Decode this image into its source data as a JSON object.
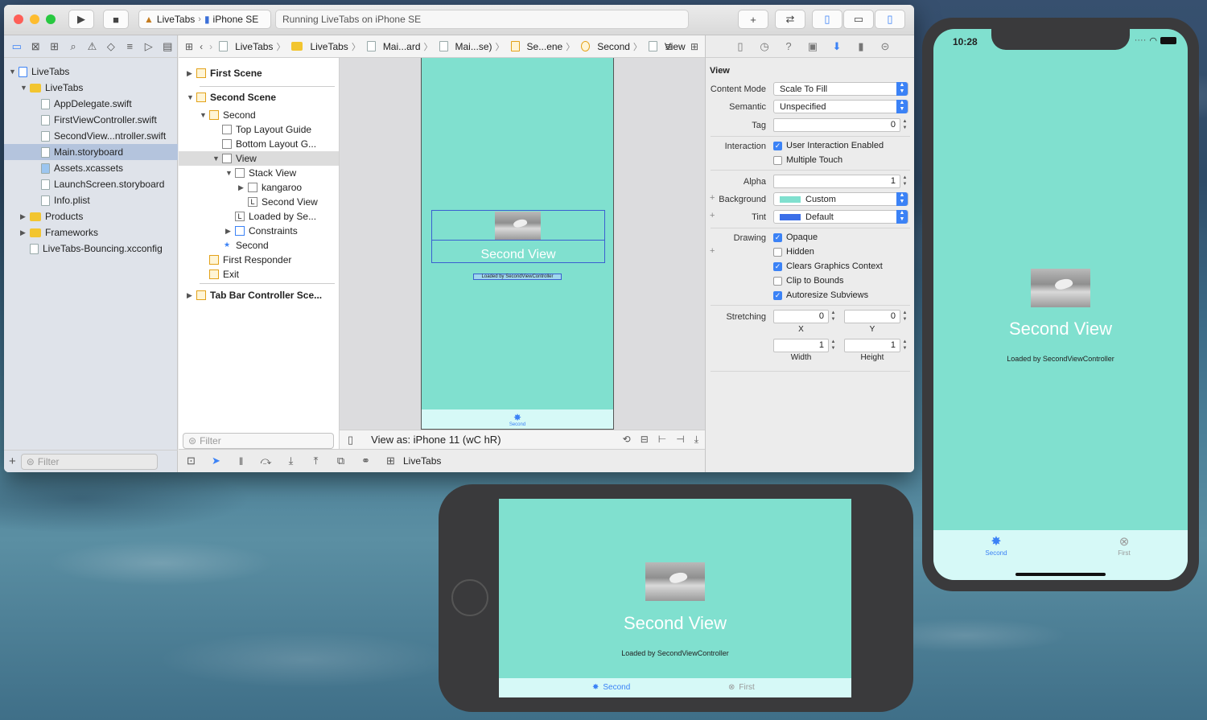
{
  "toolbar": {
    "scheme_target": "LiveTabs",
    "scheme_device": "iPhone SE",
    "status": "Running LiveTabs on iPhone SE"
  },
  "navigator": {
    "items": [
      {
        "label": "LiveTabs",
        "kind": "project"
      },
      {
        "label": "LiveTabs",
        "kind": "folder"
      },
      {
        "label": "AppDelegate.swift",
        "kind": "file"
      },
      {
        "label": "FirstViewController.swift",
        "kind": "file"
      },
      {
        "label": "SecondView...ntroller.swift",
        "kind": "file"
      },
      {
        "label": "Main.storyboard",
        "kind": "file",
        "selected": true
      },
      {
        "label": "Assets.xcassets",
        "kind": "assets"
      },
      {
        "label": "LaunchScreen.storyboard",
        "kind": "file"
      },
      {
        "label": "Info.plist",
        "kind": "file"
      },
      {
        "label": "Products",
        "kind": "folder"
      },
      {
        "label": "Frameworks",
        "kind": "folder"
      },
      {
        "label": "LiveTabs-Bouncing.xcconfig",
        "kind": "file"
      }
    ],
    "filter_placeholder": "Filter"
  },
  "jumpbar": [
    "LiveTabs",
    "LiveTabs",
    "Mai...ard",
    "Mai...se)",
    "Se...ene",
    "Second",
    "View"
  ],
  "outline": {
    "rows": [
      {
        "label": "First Scene",
        "bold": true
      },
      {
        "label": "Second Scene",
        "bold": true
      },
      {
        "label": "Second"
      },
      {
        "label": "Top Layout Guide"
      },
      {
        "label": "Bottom Layout G..."
      },
      {
        "label": "View"
      },
      {
        "label": "Stack View"
      },
      {
        "label": "kangaroo"
      },
      {
        "label": "Second View"
      },
      {
        "label": "Loaded by Se..."
      },
      {
        "label": "Constraints"
      },
      {
        "label": "Second"
      },
      {
        "label": "First Responder"
      },
      {
        "label": "Exit"
      },
      {
        "label": "Tab Bar Controller Sce...",
        "bold": true
      }
    ],
    "filter_placeholder": "Filter"
  },
  "canvas": {
    "title": "Second View",
    "subtitle": "Loaded by SecondViewController",
    "tab_label": "Second",
    "view_as": "View as: iPhone 11 (wC hR)"
  },
  "debug": {
    "target": "LiveTabs"
  },
  "inspector": {
    "section": "View",
    "content_mode_label": "Content Mode",
    "content_mode": "Scale To Fill",
    "semantic_label": "Semantic",
    "semantic": "Unspecified",
    "tag_label": "Tag",
    "tag": "0",
    "interaction_label": "Interaction",
    "user_interaction": "User Interaction Enabled",
    "multiple_touch": "Multiple Touch",
    "alpha_label": "Alpha",
    "alpha": "1",
    "background_label": "Background",
    "background": "Custom",
    "tint_label": "Tint",
    "tint": "Default",
    "drawing_label": "Drawing",
    "opaque": "Opaque",
    "hidden": "Hidden",
    "clears": "Clears Graphics Context",
    "clip": "Clip to Bounds",
    "autoresize": "Autoresize Subviews",
    "stretching_label": "Stretching",
    "sx": "0",
    "sy": "0",
    "sw": "1",
    "sh": "1",
    "x_label": "X",
    "y_label": "Y",
    "width_label": "Width",
    "height_label": "Height"
  },
  "iphonex": {
    "time": "10:28",
    "title": "Second View",
    "subtitle": "Loaded by SecondViewController",
    "tab1": "Second",
    "tab2": "First"
  },
  "iphonese": {
    "title": "Second View",
    "subtitle": "Loaded by SecondViewController",
    "tab1": "Second",
    "tab2": "First"
  },
  "colors": {
    "view_bg": "#80e0cf",
    "tabbar_bg": "#d6f9f7",
    "accent": "#3b82f6"
  }
}
